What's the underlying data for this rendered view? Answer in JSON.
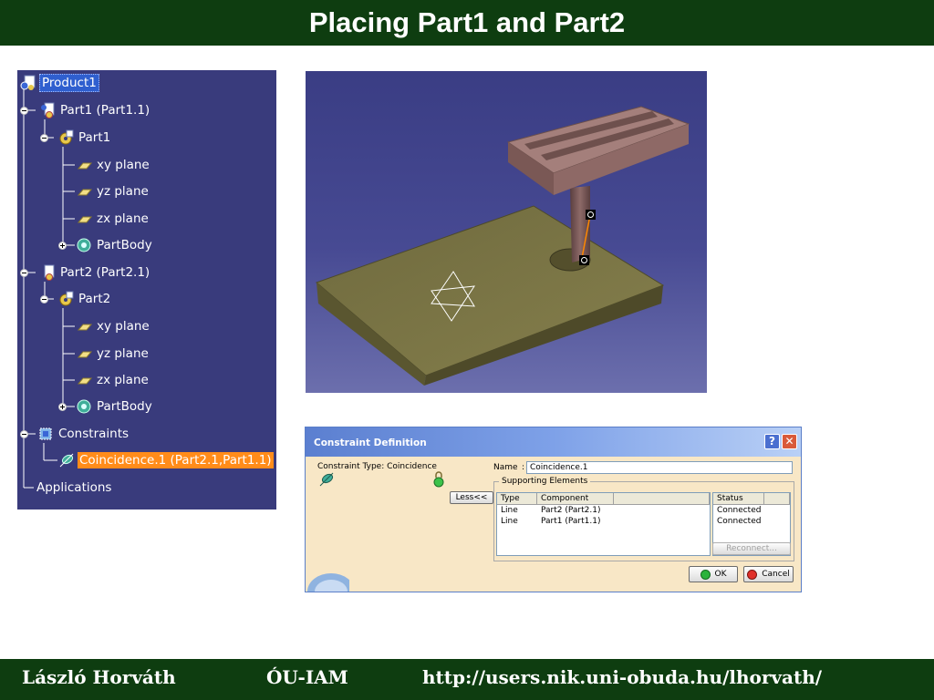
{
  "slide": {
    "title": "Placing Part1 and Part2",
    "footer": {
      "author": "László Horváth",
      "institute": "ÓU-IAM",
      "url": "http://users.nik.uni-obuda.hu/lhorvath/"
    }
  },
  "tree": {
    "items": [
      {
        "label": "Product1",
        "icon": "product-icon"
      },
      {
        "label": "Part1 (Part1.1)",
        "icon": "part-instance-icon"
      },
      {
        "label": "Part1",
        "icon": "part-icon"
      },
      {
        "label": "xy plane",
        "icon": "plane-icon"
      },
      {
        "label": "yz plane",
        "icon": "plane-icon"
      },
      {
        "label": "zx plane",
        "icon": "plane-icon"
      },
      {
        "label": "PartBody",
        "icon": "partbody-icon"
      },
      {
        "label": "Part2 (Part2.1)",
        "icon": "part-instance-icon"
      },
      {
        "label": "Part2",
        "icon": "part-icon"
      },
      {
        "label": "xy plane",
        "icon": "plane-icon"
      },
      {
        "label": "yz plane",
        "icon": "plane-icon"
      },
      {
        "label": "zx plane",
        "icon": "plane-icon"
      },
      {
        "label": "PartBody",
        "icon": "partbody-icon"
      },
      {
        "label": "Constraints",
        "icon": "constraints-icon"
      },
      {
        "label": "Coincidence.1 (Part2.1,Part1.1)",
        "icon": "coincidence-icon"
      },
      {
        "label": "Applications",
        "icon": ""
      }
    ]
  },
  "dialog": {
    "title": "Constraint Definition",
    "help_label": "?",
    "close_label": "✕",
    "constraint_type_label": "Constraint Type: Coincidence",
    "name_label": "Name",
    "name_value": "Coincidence.1",
    "less_button": "Less<<",
    "supporting_elements_label": "Supporting Elements",
    "columns": {
      "type": "Type",
      "component": "Component",
      "status": "Status"
    },
    "rows": [
      {
        "type": "Line",
        "component": "Part2 (Part2.1)",
        "status": "Connected"
      },
      {
        "type": "Line",
        "component": "Part1 (Part1.1)",
        "status": "Connected"
      }
    ],
    "reconnect_button": "Reconnect...",
    "ok_button": "OK",
    "cancel_button": "Cancel"
  },
  "colors": {
    "slide_bar": "#0e3d10",
    "tree_background": "#393b7c",
    "selected_orange": "#ff8c1a",
    "selected_blue": "#2f5fcf",
    "dialog_background": "#f8e7c6"
  }
}
